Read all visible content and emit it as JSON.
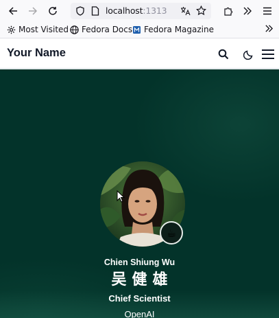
{
  "browser": {
    "url_host": "localhost",
    "url_port": ":1313",
    "icons": {
      "back": "arrow-left-icon",
      "forward": "arrow-right-icon",
      "reload": "reload-icon",
      "shield": "shield-icon",
      "page": "page-icon",
      "translate": "translate-icon",
      "bookmark_star": "star-icon",
      "extensions": "puzzle-icon",
      "overflow": "chevrons-right-icon",
      "menu": "hamburger-icon"
    }
  },
  "bookmarks": {
    "items": [
      {
        "label": "Most Visited",
        "icon": "gear-icon"
      },
      {
        "label": "Fedora Docs",
        "icon": "globe-icon"
      },
      {
        "label": "Fedora Magazine",
        "icon": "magazine-icon"
      }
    ]
  },
  "site": {
    "title": "Your Name",
    "icons": {
      "search": "search-icon",
      "theme": "moon-icon",
      "menu": "hamburger-icon"
    }
  },
  "hero": {
    "name_en": "Chien Shiung Wu",
    "name_zh": "吴健雄",
    "role": "Chief Scientist",
    "organization": "OpenAI",
    "badge": "☕",
    "colors": {
      "background": "#03332a",
      "text": "#ffffff"
    }
  }
}
